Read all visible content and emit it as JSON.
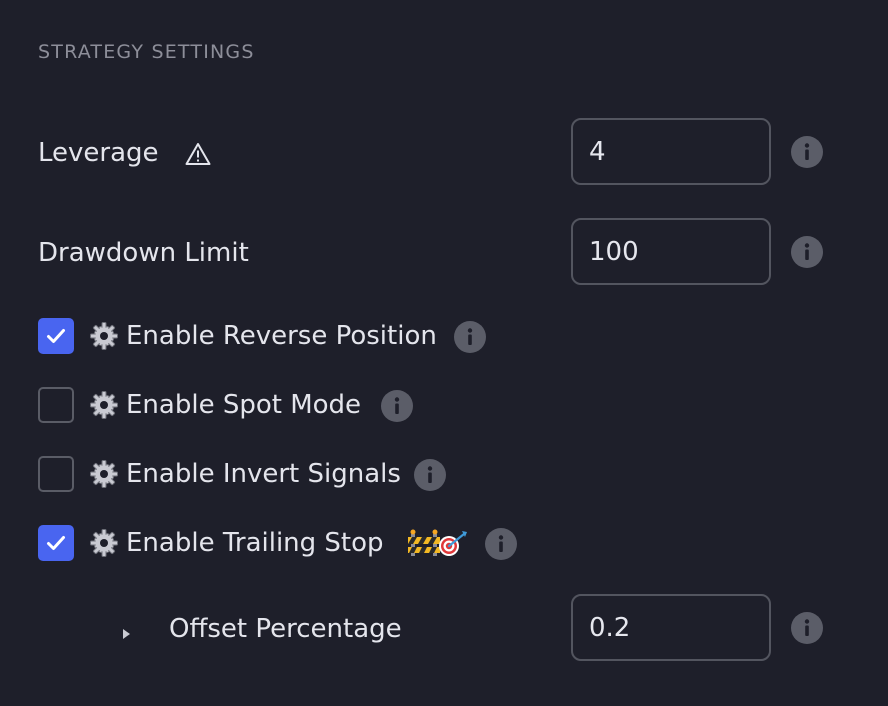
{
  "section": {
    "title": "STRATEGY SETTINGS"
  },
  "fields": {
    "leverage": {
      "label": "Leverage",
      "value": "4",
      "icon": "warning-icon"
    },
    "drawdown": {
      "label": "Drawdown Limit",
      "value": "100"
    },
    "offset": {
      "label": "Offset Percentage",
      "value": "0.2"
    }
  },
  "toggles": {
    "reverse_position": {
      "label": "Enable Reverse Position",
      "checked": true,
      "icon": "gear-icon"
    },
    "spot_mode": {
      "label": "Enable Spot Mode",
      "checked": false,
      "icon": "gear-icon"
    },
    "invert_signals": {
      "label": "Enable Invert Signals",
      "checked": false,
      "icon": "gear-icon"
    },
    "trailing_stop": {
      "label": "Enable Trailing Stop",
      "checked": true,
      "icon": "gear-icon",
      "badge_icons": [
        "construction-icon",
        "target-icon"
      ]
    }
  },
  "colors": {
    "background": "#1e1f2a",
    "accent": "#4965f0",
    "muted_text": "#8d8e99",
    "info_icon": "#5b5d68"
  }
}
